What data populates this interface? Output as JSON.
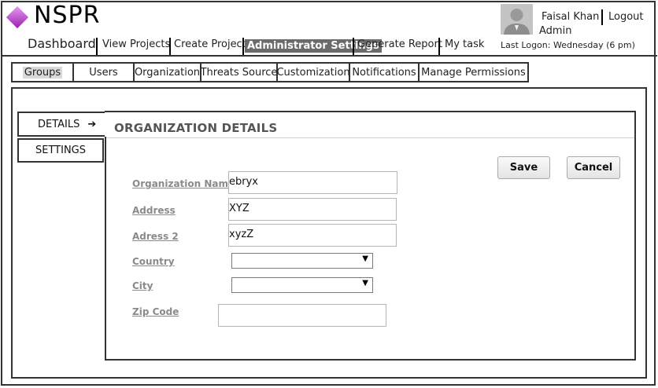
{
  "app": {
    "logo_text": "NSPR"
  },
  "nav": {
    "dashboard": "Dashboard",
    "view_projects": "View Projects",
    "create_project": "Create Project",
    "admin_settings": "Administrator Settings",
    "generate_report": "Generate Report",
    "my_task": "My task"
  },
  "user": {
    "name": "Faisal Khan",
    "role": "Admin",
    "logout": "Logout",
    "last_logon": "Last Logon:  Wednesday (6 pm)"
  },
  "tabs": [
    "Groups",
    "Users",
    "Organization",
    "Threats Source",
    "Customization",
    "Notifications",
    "Manage Permissions"
  ],
  "sidebar": {
    "details": "DETAILS",
    "details_arrow": "➔",
    "settings": "SETTINGS"
  },
  "panel": {
    "title": "ORGANIZATION DETAILS"
  },
  "buttons": {
    "save": "Save",
    "cancel": "Cancel"
  },
  "form": {
    "org_name_label": "Organization Name",
    "org_name_value": "ebryx",
    "address_label": "Address",
    "address_value": "XYZ",
    "address2_label": "Adress 2",
    "address2_value": "xyzZ",
    "country_label": "Country",
    "country_value": "",
    "city_label": "City",
    "city_value": "",
    "zip_label": "Zip Code",
    "zip_value": ""
  },
  "colors": {
    "active_nav_bg": "#6b6b6b",
    "logo_gradient_start": "#e59cf0",
    "logo_gradient_end": "#9b1fb2"
  }
}
